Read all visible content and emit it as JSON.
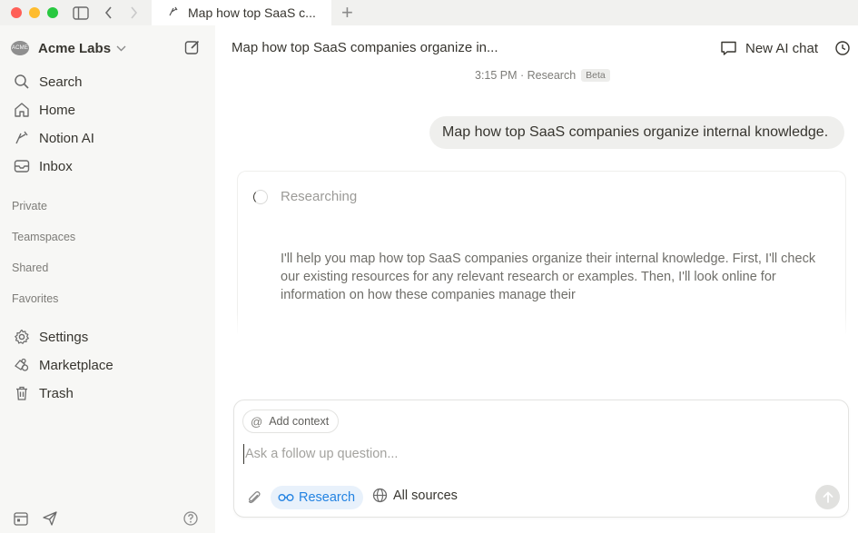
{
  "window": {
    "tab_title": "Map how top SaaS c...",
    "new_tab_label": "+"
  },
  "sidebar": {
    "workspace_logo_text": "ACME",
    "workspace_name": "Acme Labs",
    "nav": [
      {
        "label": "Search",
        "icon": "search-icon"
      },
      {
        "label": "Home",
        "icon": "home-icon"
      },
      {
        "label": "Notion AI",
        "icon": "notion-ai-icon"
      },
      {
        "label": "Inbox",
        "icon": "inbox-icon"
      }
    ],
    "sections": [
      "Private",
      "Teamspaces",
      "Shared",
      "Favorites"
    ],
    "bottom_nav": [
      {
        "label": "Settings",
        "icon": "gear-icon"
      },
      {
        "label": "Marketplace",
        "icon": "marketplace-icon"
      },
      {
        "label": "Trash",
        "icon": "trash-icon"
      }
    ]
  },
  "header": {
    "title": "Map how top SaaS companies organize in...",
    "new_ai_chat": "New AI chat",
    "meta": "3:15 PM · Research",
    "beta": "Beta"
  },
  "chat": {
    "user_message": "Map how top SaaS companies organize internal knowledge.",
    "status": "Researching",
    "response": "I'll help you map how top SaaS companies organize their internal knowledge. First, I'll check our existing resources for any relevant research or examples. Then, I'll look online for information on how these companies manage their"
  },
  "composer": {
    "add_context": "Add context",
    "placeholder": "Ask a follow up question...",
    "value": "",
    "research": "Research",
    "all_sources": "All sources"
  },
  "colors": {
    "accent": "#2383e2",
    "sidebar_bg": "#f7f7f5",
    "bubble_bg": "#efefed"
  }
}
